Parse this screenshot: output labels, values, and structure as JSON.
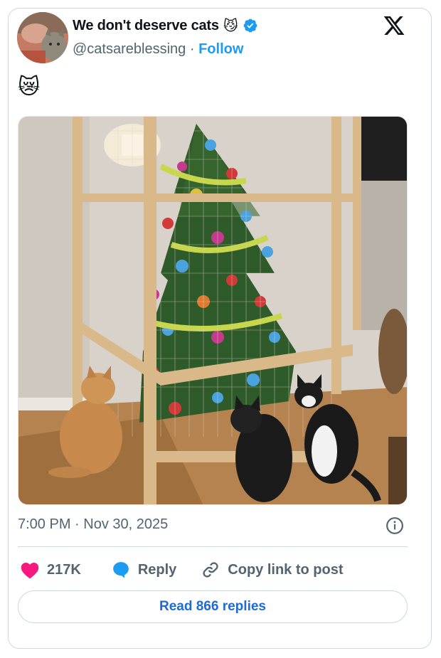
{
  "author": {
    "display_name": "We don't deserve cats",
    "name_emoji": "😼",
    "handle": "@catsareblessing",
    "separator": "·",
    "follow_label": "Follow"
  },
  "tweet": {
    "text": "😿",
    "timestamp": "7:00 PM · Nov 30, 2025"
  },
  "actions": {
    "like_count": "217K",
    "reply_label": "Reply",
    "copy_link_label": "Copy link to post"
  },
  "read_replies_label": "Read 866 replies",
  "colors": {
    "accent": "#1d9bf0",
    "heart": "#f91880",
    "secondary_text": "#536471",
    "border": "#cfd9de"
  },
  "icons": [
    "x-logo-icon",
    "verified-badge-icon",
    "info-icon",
    "heart-icon",
    "reply-bubble-icon",
    "link-icon"
  ]
}
